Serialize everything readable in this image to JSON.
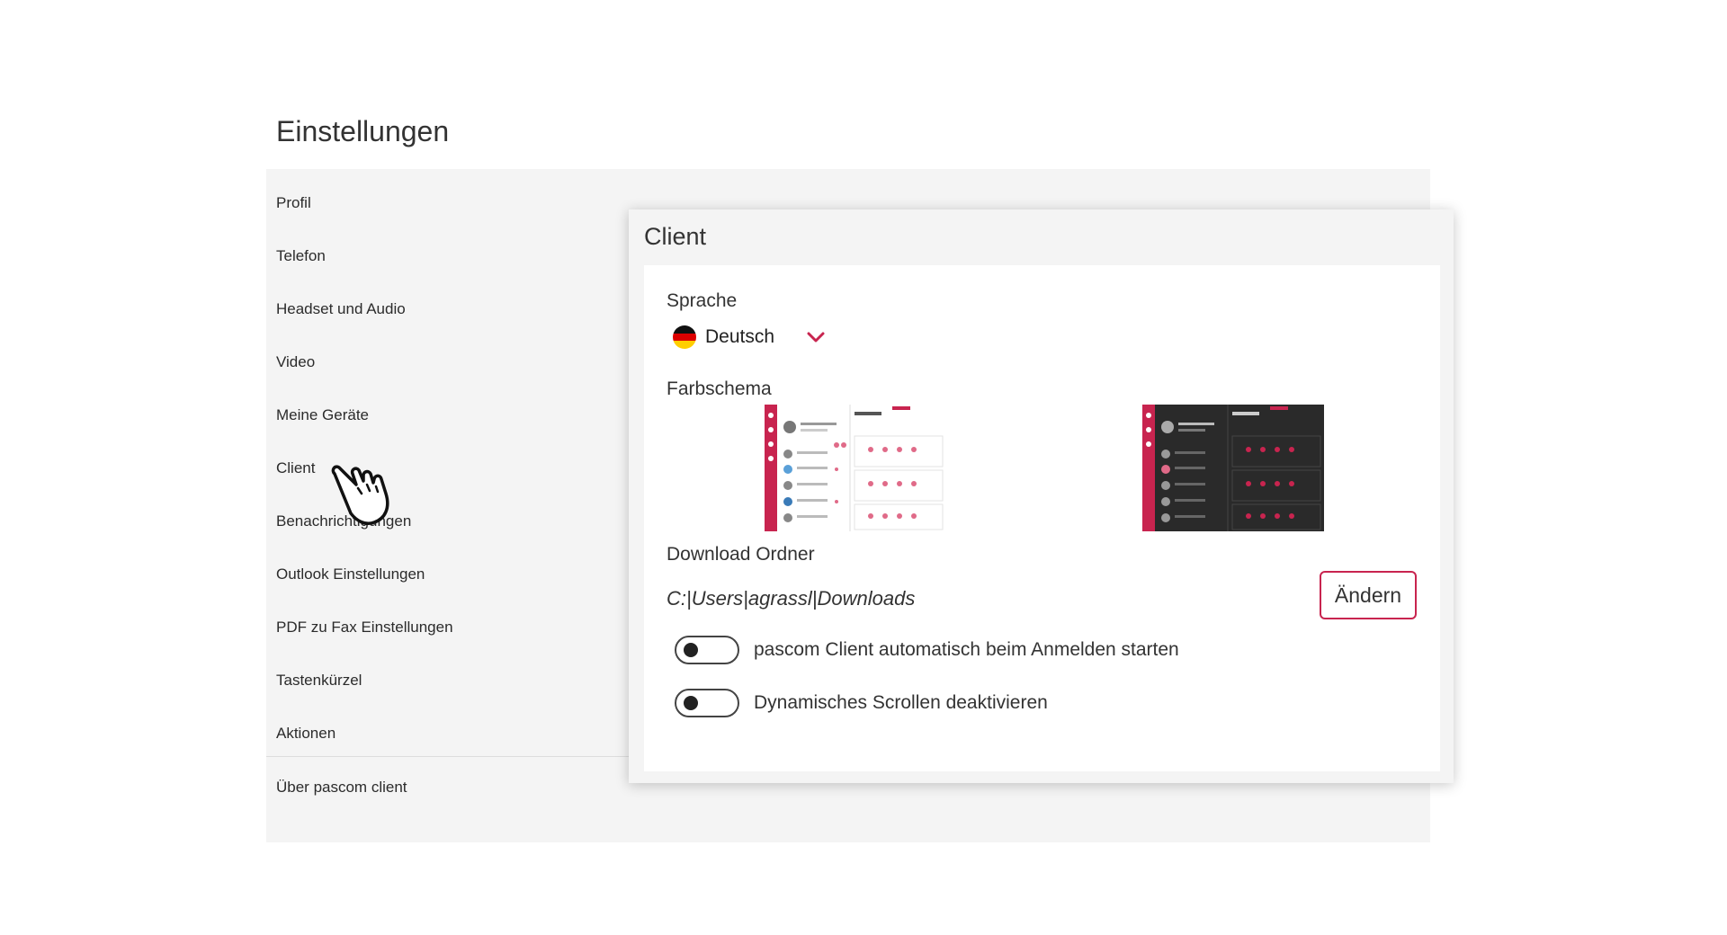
{
  "page": {
    "title": "Einstellungen"
  },
  "sidebar": {
    "items": [
      {
        "label": "Profil"
      },
      {
        "label": "Telefon"
      },
      {
        "label": "Headset und Audio"
      },
      {
        "label": "Video"
      },
      {
        "label": "Meine Geräte"
      },
      {
        "label": "Client"
      },
      {
        "label": "Benachrichtigungen"
      },
      {
        "label": "Outlook Einstellungen"
      },
      {
        "label": "PDF zu Fax Einstellungen"
      },
      {
        "label": "Tastenkürzel"
      },
      {
        "label": "Aktionen"
      },
      {
        "label": "Über pascom client"
      }
    ],
    "selected": "Client"
  },
  "client": {
    "title": "Client",
    "language": {
      "label": "Sprache",
      "value": "Deutsch",
      "flag_icon": "german-flag-icon"
    },
    "color_scheme": {
      "label": "Farbschema",
      "options": [
        "light",
        "dark"
      ]
    },
    "download": {
      "label": "Download Ordner",
      "path": "C:|Users|agrassl|Downloads",
      "change_label": "Ändern"
    },
    "toggles": [
      {
        "label": "pascom Client automatisch beim Anmelden starten",
        "on": false
      },
      {
        "label": "Dynamisches Scrollen deaktivieren",
        "on": false
      }
    ]
  },
  "colors": {
    "accent": "#c8244f",
    "panel_bg": "#f4f4f4",
    "dark_theme_bg": "#2a2a2a"
  }
}
